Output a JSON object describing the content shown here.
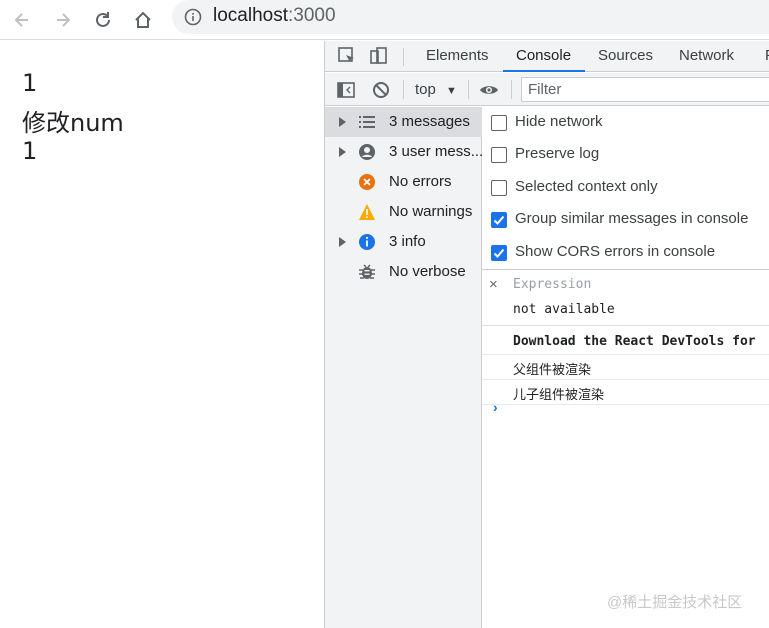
{
  "browser": {
    "url_host": "localhost",
    "url_port": ":3000"
  },
  "page": {
    "lines": [
      "1",
      "修改num",
      "1"
    ]
  },
  "devtools": {
    "tabs": [
      "Elements",
      "Console",
      "Sources",
      "Network",
      "P"
    ],
    "active_tab": "Console",
    "toolbar": {
      "context": "top",
      "filter_placeholder": "Filter"
    },
    "sidebar": [
      {
        "label": "3 messages",
        "icon": "list-icon",
        "expandable": true,
        "selected": true
      },
      {
        "label": "3 user mess...",
        "icon": "user-icon",
        "expandable": true,
        "selected": false
      },
      {
        "label": "No errors",
        "icon": "error-icon",
        "expandable": false,
        "selected": false
      },
      {
        "label": "No warnings",
        "icon": "warning-icon",
        "expandable": false,
        "selected": false
      },
      {
        "label": "3 info",
        "icon": "info-icon",
        "expandable": true,
        "selected": false
      },
      {
        "label": "No verbose",
        "icon": "bug-icon",
        "expandable": false,
        "selected": false
      }
    ],
    "settings": [
      {
        "label": "Hide network",
        "checked": false
      },
      {
        "label": "Preserve log",
        "checked": false
      },
      {
        "label": "Selected context only",
        "checked": false
      },
      {
        "label": "Group similar messages in console",
        "checked": true
      },
      {
        "label": "Show CORS errors in console",
        "checked": true
      }
    ],
    "expression": {
      "close": "×",
      "label": "Expression",
      "value": "not available"
    },
    "logs": [
      {
        "text": "Download the React DevTools for",
        "bold": true
      },
      {
        "text": "父组件被渲染",
        "bold": false
      },
      {
        "text": "儿子组件被渲染",
        "bold": false
      }
    ],
    "prompt": "›"
  },
  "watermark": "@稀土掘金技术社区",
  "colors": {
    "accent": "#1a73e8",
    "error": "#e8710a",
    "warning": "#f9ab00",
    "info": "#1a73e8"
  }
}
